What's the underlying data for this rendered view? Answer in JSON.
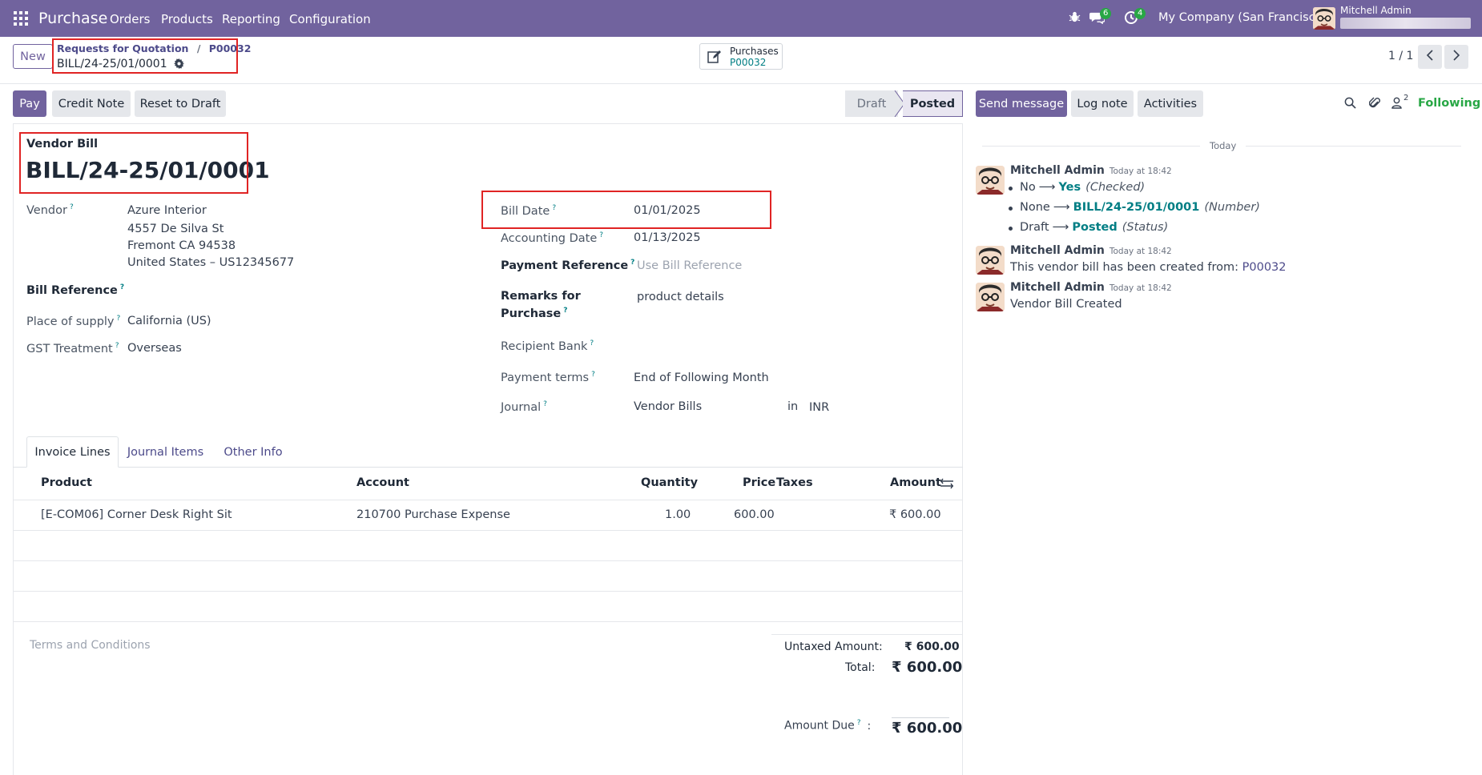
{
  "navbar": {
    "app_name": "Purchase",
    "menu": [
      "Orders",
      "Products",
      "Reporting",
      "Configuration"
    ],
    "chat_count": "6",
    "activity_count": "4",
    "company": "My Company (San Francisco)",
    "user": "Mitchell Admin"
  },
  "control": {
    "new_label": "New",
    "breadcrumb_parent": "Requests for Quotation",
    "breadcrumb_sep": "/",
    "breadcrumb_po": "P00032",
    "record_name": "BILL/24-25/01/0001",
    "smart_button_label": "Purchases",
    "smart_button_value": "P00032",
    "pager": "1 / 1"
  },
  "statusbar": {
    "buttons": [
      "Pay",
      "Credit Note",
      "Reset to Draft"
    ],
    "states": [
      "Draft",
      "Posted"
    ],
    "active_state": "Posted"
  },
  "form": {
    "doc_type": "Vendor Bill",
    "name": "BILL/24-25/01/0001",
    "vendor_label": "Vendor",
    "vendor_name": "Azure Interior",
    "vendor_address": [
      "4557 De Silva St",
      "Fremont CA 94538",
      "United States – US12345677"
    ],
    "bill_reference_label": "Bill Reference",
    "place_of_supply_label": "Place of supply",
    "place_of_supply": "California (US)",
    "gst_label": "GST Treatment",
    "gst_value": "Overseas",
    "bill_date_label": "Bill Date",
    "bill_date": "01/01/2025",
    "accounting_date_label": "Accounting Date",
    "accounting_date": "01/13/2025",
    "payment_ref_label": "Payment Reference",
    "payment_ref_placeholder": "Use Bill Reference",
    "remarks_label_1": "Remarks for",
    "remarks_label_2": "Purchase",
    "remarks_value": "product details",
    "recipient_bank_label": "Recipient Bank",
    "payment_terms_label": "Payment terms",
    "payment_terms": "End of Following Month",
    "journal_label": "Journal",
    "journal": "Vendor Bills",
    "in_label": "in",
    "currency": "INR"
  },
  "tabs": [
    "Invoice Lines",
    "Journal Items",
    "Other Info"
  ],
  "lines": {
    "headers": [
      "Product",
      "Account",
      "Quantity",
      "Price",
      "Taxes",
      "Amount"
    ],
    "rows": [
      {
        "product": "[E-COM06] Corner Desk Right Sit",
        "account": "210700 Purchase Expense",
        "quantity": "1.00",
        "price": "600.00",
        "taxes": "",
        "amount": "₹ 600.00"
      }
    ]
  },
  "totals": {
    "terms_placeholder": "Terms and Conditions",
    "untaxed_label": "Untaxed Amount:",
    "untaxed": "₹ 600.00",
    "total_label": "Total:",
    "total": "₹ 600.00",
    "due_label": "Amount Due",
    "due_colon": ":",
    "due": "₹ 600.00"
  },
  "chatter": {
    "send_message": "Send message",
    "log_note": "Log note",
    "activities": "Activities",
    "followers_count": "2",
    "following": "Following",
    "date_separator": "Today",
    "messages": [
      {
        "author": "Mitchell Admin",
        "time": "Today at 18:42",
        "tracking": [
          {
            "old": "No",
            "new": "Yes",
            "field": "(Checked)"
          },
          {
            "old": "None",
            "new": "BILL/24-25/01/0001",
            "field": "(Number)"
          },
          {
            "old": "Draft",
            "new": "Posted",
            "field": "(Status)"
          }
        ]
      },
      {
        "author": "Mitchell Admin",
        "time": "Today at 18:42",
        "body": "This vendor bill has been created from:",
        "link": "P00032"
      },
      {
        "author": "Mitchell Admin",
        "time": "Today at 18:42",
        "body": "Vendor Bill Created"
      }
    ]
  },
  "colors": {
    "brand": "#71639e",
    "teal": "#017e84",
    "highlight": "#e02424"
  }
}
